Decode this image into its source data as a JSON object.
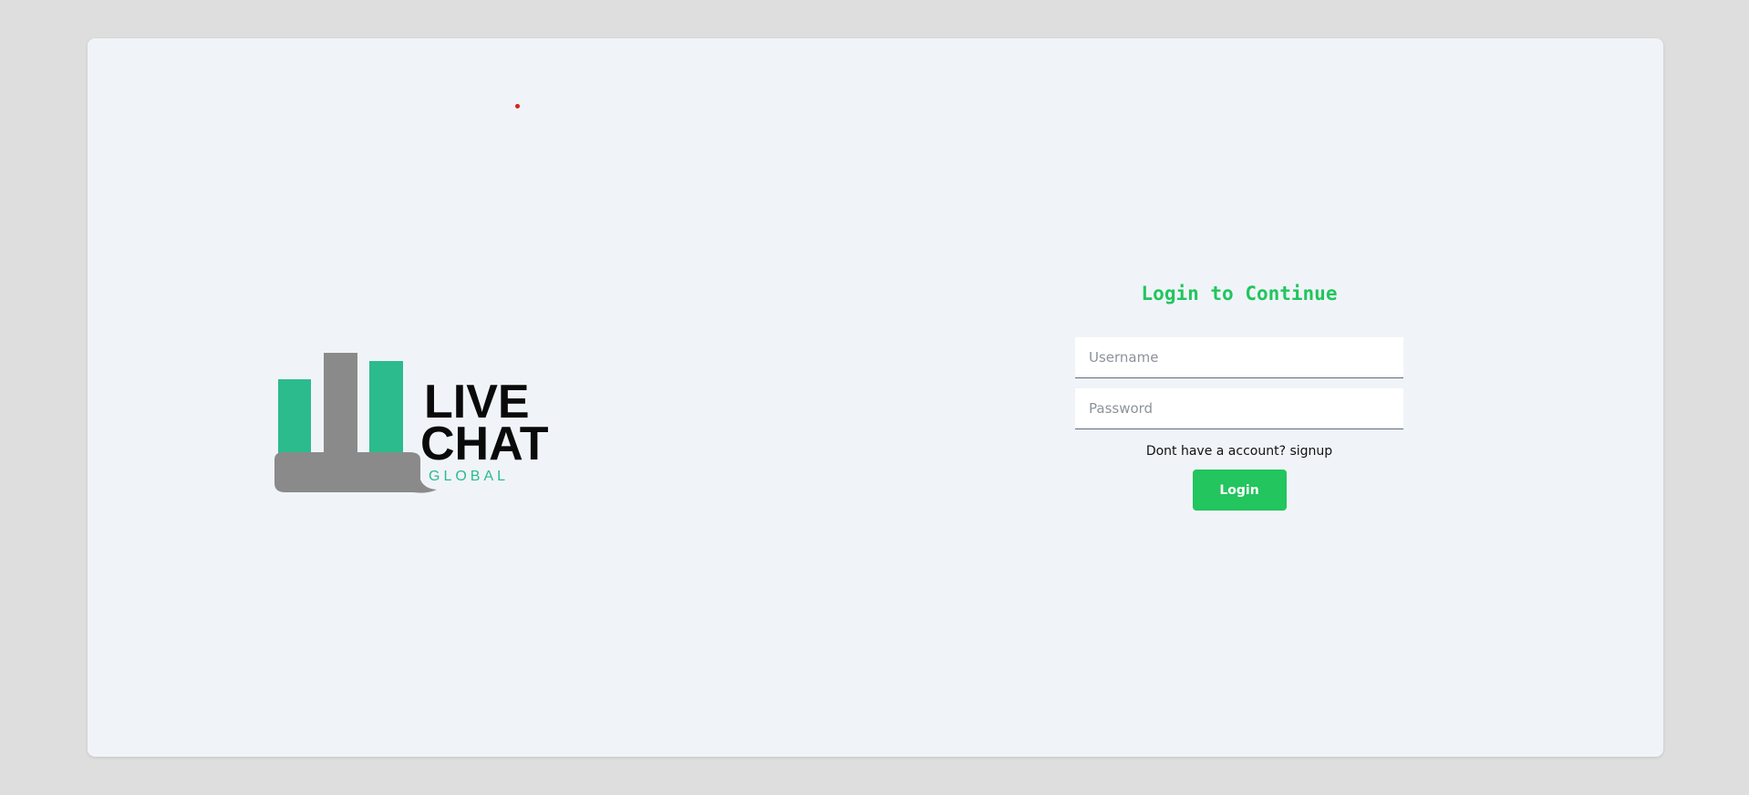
{
  "logo": {
    "line1": "LIVE",
    "line2": "CHAT",
    "line3": "GLOBAL",
    "colors": {
      "green": "#2bbb8c",
      "gray": "#8a8a8a",
      "text": "#0a0a0a"
    }
  },
  "login": {
    "title": "Login to Continue",
    "username_placeholder": "Username",
    "password_placeholder": "Password",
    "signup_prompt": "Dont have a account? ",
    "signup_link": "signup",
    "submit_label": "Login"
  },
  "colors": {
    "accent": "#22c55e",
    "card_bg": "#f0f4f9",
    "page_bg": "#dedede",
    "marker": "#d9201f"
  }
}
